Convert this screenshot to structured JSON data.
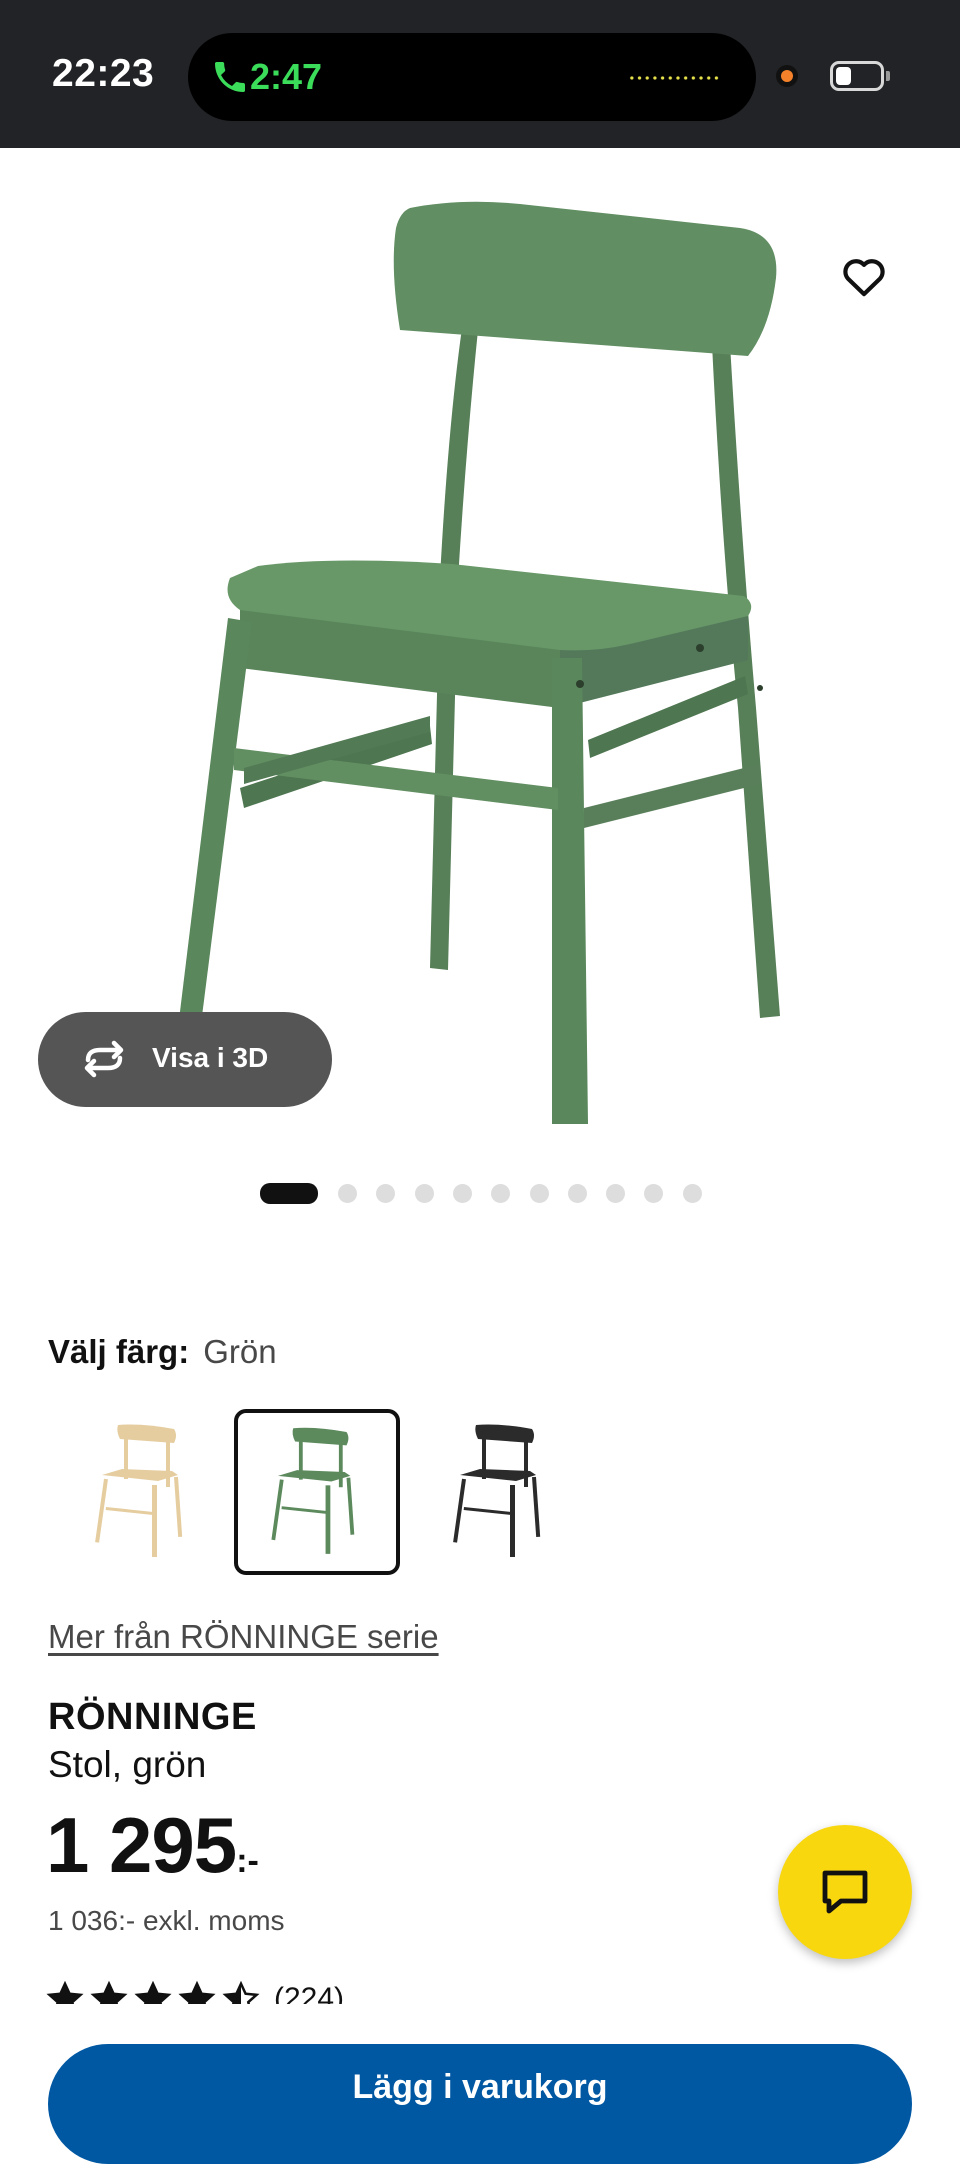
{
  "status_bar": {
    "time": "22:23",
    "call_timer": "2:47",
    "battery_level": 0.35
  },
  "product": {
    "favorite_icon": "heart-outline-icon",
    "view_3d_label": "Visa i 3D",
    "view_3d_icon": "rotate-arrows-icon",
    "image_count": 12,
    "active_image_index": 0,
    "color_label": "Välj färg:",
    "color_value": "Grön",
    "colors": [
      {
        "name": "birch",
        "hex": "#e8d2a6",
        "selected": false
      },
      {
        "name": "green",
        "hex": "#5a8a5c",
        "selected": true
      },
      {
        "name": "black",
        "hex": "#2b2b2b",
        "selected": false
      }
    ],
    "series_link": "Mer från RÖNNINGE serie",
    "name": "RÖNNINGE",
    "description": "Stol, grön",
    "price": "1 295",
    "price_suffix": ":-",
    "price_excl_vat": "1 036:- exkl. moms",
    "rating": 4.5,
    "rating_count": "(224)",
    "buy_button_label": "Lägg i varukorg"
  },
  "chat_button": {
    "icon": "chat-bubble-icon"
  },
  "colors": {
    "status_bg": "#222326",
    "call_green": "#3bdc5a",
    "chat_yellow": "#f8d70f",
    "ikea_blue": "#0058a3",
    "chair_green": "#5e8a5f"
  }
}
